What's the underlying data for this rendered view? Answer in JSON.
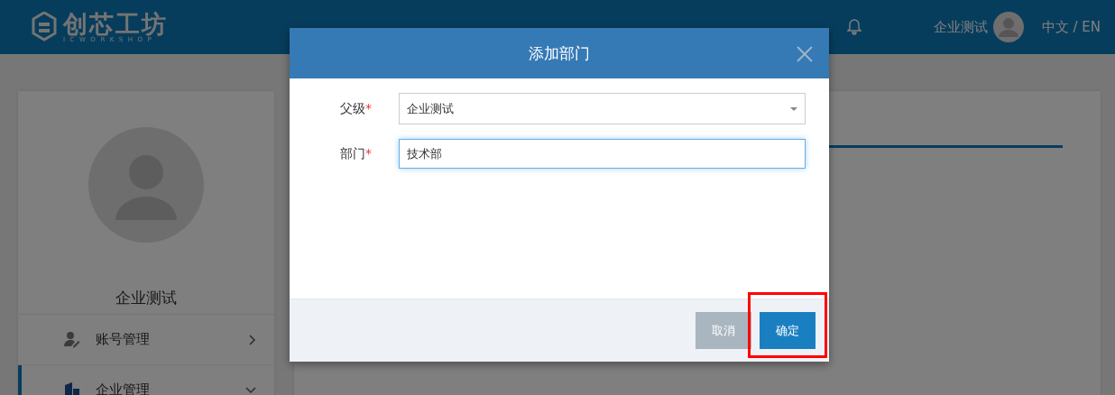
{
  "header": {
    "logo_text": "创芯工坊",
    "logo_subtext": "ICWORKSHOP",
    "user_name": "企业测试",
    "language": "中文 / EN"
  },
  "sidebar": {
    "user_name": "企业测试",
    "items": [
      {
        "label": "账号管理",
        "selected": false,
        "expanded": false
      },
      {
        "label": "企业管理",
        "selected": true,
        "expanded": true
      }
    ]
  },
  "dialog": {
    "title": "添加部门",
    "fields": [
      {
        "label": "父级",
        "required_mark": "*",
        "kind": "select",
        "value": "企业测试",
        "focused": false
      },
      {
        "label": "部门",
        "required_mark": "*",
        "kind": "text",
        "value": "技术部",
        "focused": true
      }
    ],
    "buttons": [
      {
        "label": "取消",
        "kind": "secondary",
        "highlighted": false
      },
      {
        "label": "确定",
        "kind": "primary",
        "highlighted": true
      }
    ]
  }
}
